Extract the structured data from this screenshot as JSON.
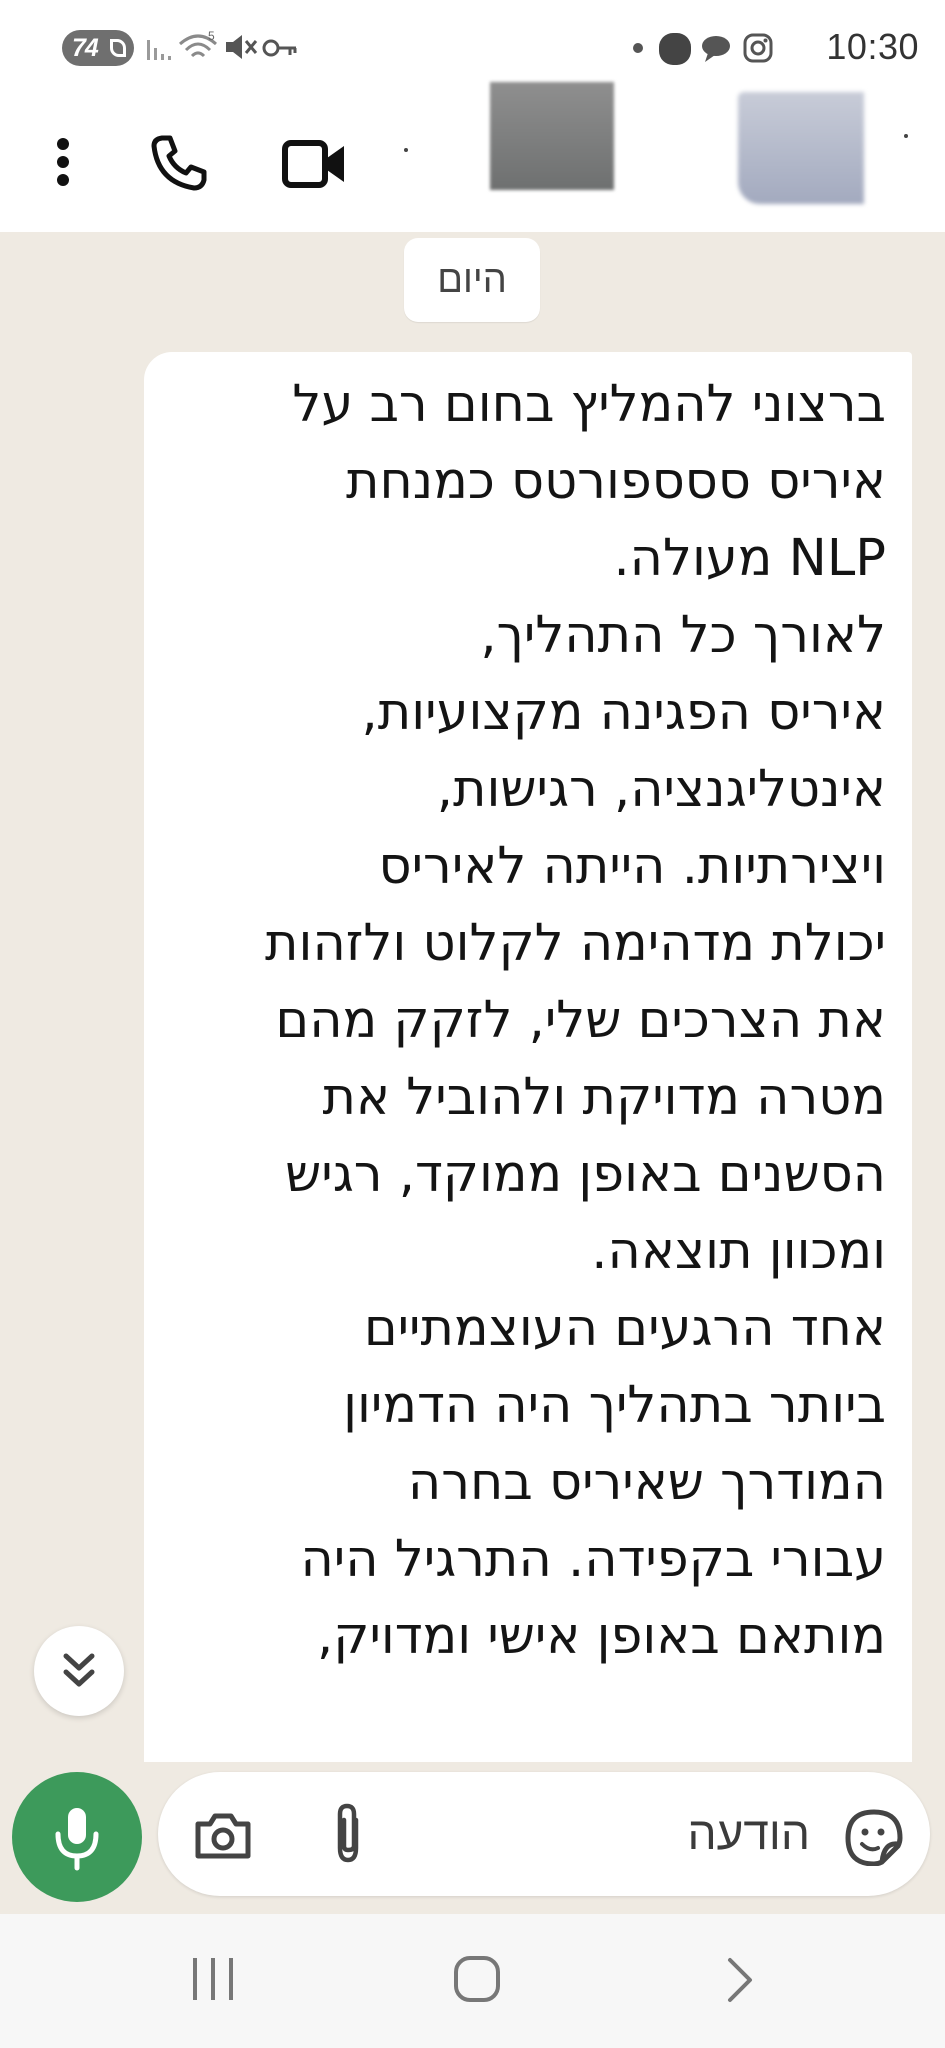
{
  "status_bar": {
    "battery": "74",
    "time": "10:30",
    "icons": [
      "battery-saver-icon",
      "signal-icon",
      "wifi-icon",
      "mute-icon",
      "vpn-key-icon",
      "notification-dot-icon",
      "notification-icon",
      "chat-icon",
      "instagram-icon"
    ]
  },
  "header": {
    "actions": [
      "more-options-icon",
      "voice-call-icon",
      "video-call-icon"
    ]
  },
  "chat": {
    "date_chip": "היום",
    "message_lines": [
      "ברצוני להמליץ בחום רב על",
      "איריס ססספורטס כמנחת",
      "NLP מעולה.",
      "לאורך כל התהליך,",
      "איריס הפגינה מקצועיות,",
      "אינטליגנציה, רגישות,",
      "ויצירתיות. הייתה לאיריס",
      "יכולת מדהימה לקלוט ולזהות",
      "את הצרכים  שלי, לזקק מהם",
      "מטרה מדויקת ולהוביל את",
      "הסשנים באופן ממוקד, רגיש",
      "ומכוון תוצאה.",
      "אחד הרגעים העוצמתיים",
      "ביותר בתהליך היה הדמיון",
      "המודרך שאיריס בחרה",
      "עבורי בקפידה. התרגיל היה",
      "מותאם באופן אישי ומדויק,"
    ]
  },
  "composer": {
    "placeholder": "הודעה"
  },
  "colors": {
    "chat_background": "#efeae2",
    "mic_button": "#3d9a5b",
    "bubble": "#ffffff"
  }
}
